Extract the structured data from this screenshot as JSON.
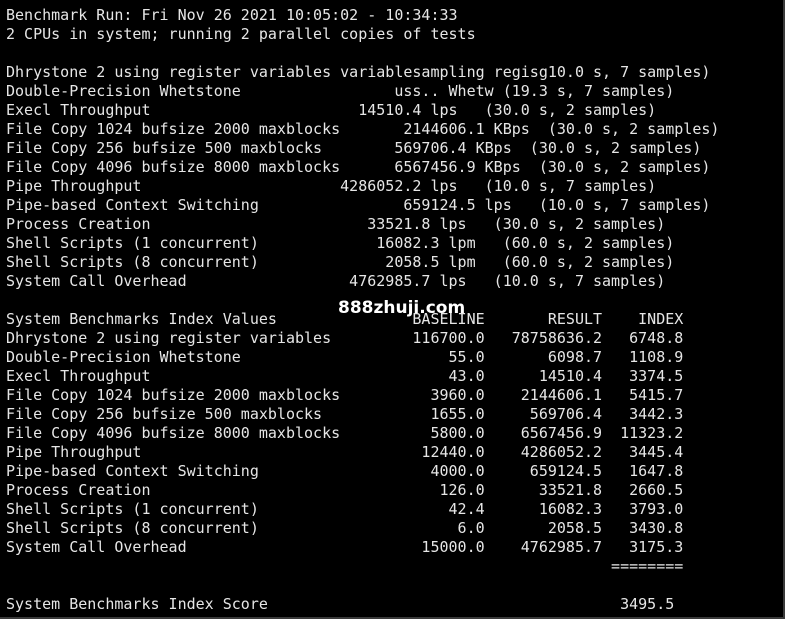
{
  "header": {
    "run_line": "Benchmark Run: Fri Nov 26 2021 10:05:02 - 10:34:33",
    "cpu_line": "2 CPUs in system; running 2 parallel copies of tests"
  },
  "raw_results": [
    "Dhrystone 2 using register variables variablesampling regisg10.0 s, 7 samples)",
    "Double-Precision Whetstone                 uss.. Whetw (19.3 s, 7 samples)",
    "Execl Throughput                       14510.4 lps   (30.0 s, 2 samples)",
    "File Copy 1024 bufsize 2000 maxblocks       2144606.1 KBps  (30.0 s, 2 samples)",
    "File Copy 256 bufsize 500 maxblocks        569706.4 KBps  (30.0 s, 2 samples)",
    "File Copy 4096 bufsize 8000 maxblocks      6567456.9 KBps  (30.0 s, 2 samples)",
    "Pipe Throughput                      4286052.2 lps   (10.0 s, 7 samples)",
    "Pipe-based Context Switching                659124.5 lps   (10.0 s, 7 samples)",
    "Process Creation                        33521.8 lps   (30.0 s, 2 samples)",
    "Shell Scripts (1 concurrent)             16082.3 lpm   (60.0 s, 2 samples)",
    "Shell Scripts (8 concurrent)              2058.5 lpm   (60.0 s, 2 samples)",
    "System Call Overhead                  4762985.7 lps   (10.0 s, 7 samples)"
  ],
  "index_header": "System Benchmarks Index Values               BASELINE       RESULT    INDEX",
  "index_rows": [
    "Dhrystone 2 using register variables         116700.0   78758636.2   6748.8",
    "Double-Precision Whetstone                       55.0       6098.7   1108.9",
    "Execl Throughput                                 43.0      14510.4   3374.5",
    "File Copy 1024 bufsize 2000 maxblocks          3960.0    2144606.1   5415.7",
    "File Copy 256 bufsize 500 maxblocks            1655.0     569706.4   3442.3",
    "File Copy 4096 bufsize 8000 maxblocks          5800.0    6567456.9  11323.2",
    "Pipe Throughput                               12440.0    4286052.2   3445.4",
    "Pipe-based Context Switching                   4000.0     659124.5   1647.8",
    "Process Creation                                126.0      33521.8   2660.5",
    "Shell Scripts (1 concurrent)                     42.4      16082.3   3793.0",
    "Shell Scripts (8 concurrent)                      6.0       2058.5   3430.8",
    "System Call Overhead                          15000.0    4762985.7   3175.3"
  ],
  "separator": "                                                                   ========",
  "score_line": "System Benchmarks Index Score                                       3495.5",
  "watermark": "888zhuji.com"
}
